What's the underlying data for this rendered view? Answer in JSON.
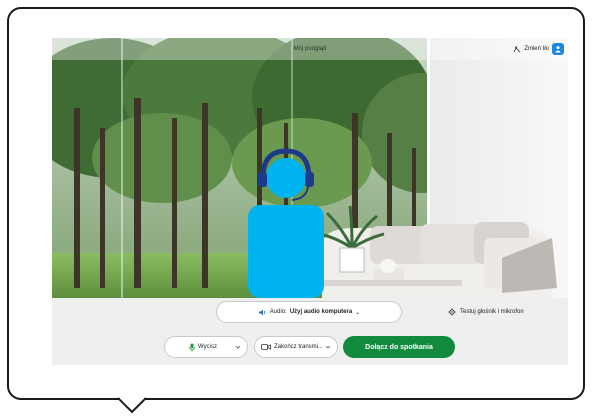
{
  "preview": {
    "title": "Mój podgląd",
    "change_background_label": "Zmień tło"
  },
  "audio": {
    "prefix": "Audio: ",
    "value": "Użyj audio komputera",
    "suffix": " ⌄"
  },
  "test_speaker_mic_label": "Testuj głośnik i mikrofon",
  "controls": {
    "mute_label": "Wycisz",
    "stop_video_label": "Zakończ transmi...",
    "join_label": "Dołącz do spotkania"
  },
  "colors": {
    "join_button": "#128a3d",
    "avatar": "#00b4f0",
    "headset": "#1d3b8a",
    "accent_badge": "#1e87d8"
  },
  "icons": [
    "microphone-icon",
    "video-camera-icon",
    "speaker-icon",
    "gear-icon",
    "change-background-icon",
    "chevron-down-icon"
  ]
}
